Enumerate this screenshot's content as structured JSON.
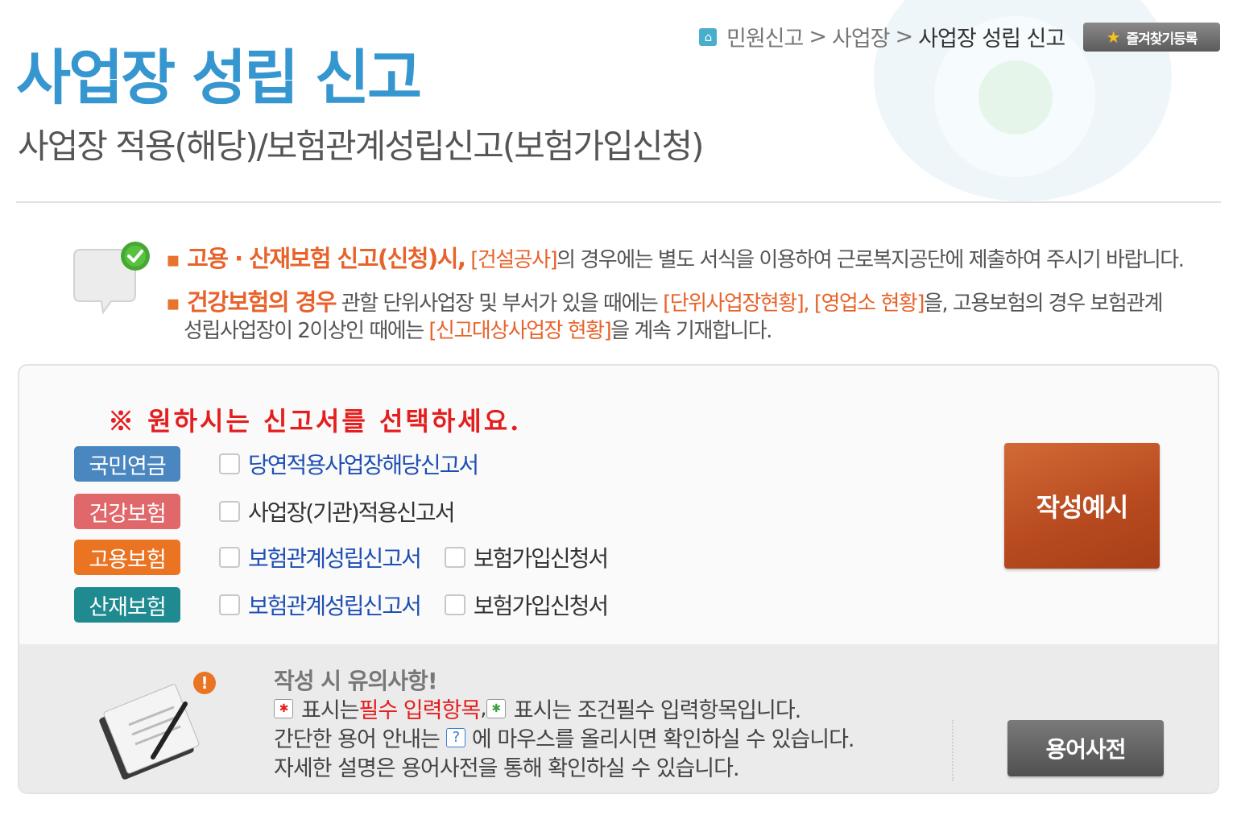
{
  "breadcrumb": {
    "items": [
      "민원신고",
      "사업장",
      "사업장 성립 신고"
    ],
    "separator": ">"
  },
  "favorites_button": {
    "label": "즐겨찾기등록",
    "icon": "star-icon"
  },
  "page": {
    "title": "사업장 성립 신고",
    "subtitle": "사업장 적용(해당)/보험관계성립신고(보험가입신청)"
  },
  "notices": {
    "n1": {
      "highlight": "고용 · 산재보험 신고(신청)시,",
      "link": "[건설공사]",
      "rest": "의 경우에는 별도 서식을 이용하여 근로복지공단에 제출하여 주시기 바랍니다."
    },
    "n2": {
      "highlight": "건강보험의 경우",
      "text1": " 관할 단위사업장 및 부서가 있을 때에는 ",
      "link1": "[단위사업장현황], [영업소 현황]",
      "text2": "을, 고용보험의 경우 보험관계",
      "text3": "성립사업장이 2이상인 때에는 ",
      "link2": "[신고대상사업장 현황]",
      "text4": "을 계속 기재합니다."
    }
  },
  "selection": {
    "heading": "※ 원하시는 신고서를 선택하세요.",
    "rows": [
      {
        "tag": "국민연금",
        "color": "#4a86c0",
        "options": [
          "당연적용사업장해당신고서"
        ]
      },
      {
        "tag": "건강보험",
        "color": "#e0676a",
        "options": [
          "사업장(기관)적용신고서"
        ]
      },
      {
        "tag": "고용보험",
        "color": "#ea7422",
        "options": [
          "보험관계성립신고서",
          "보험가입신청서"
        ]
      },
      {
        "tag": "산재보험",
        "color": "#1f8a90",
        "options": [
          "보험관계성립신고서",
          "보험가입신청서"
        ]
      }
    ],
    "example_button": "작성예시"
  },
  "info": {
    "title": "작성 시 유의사항!",
    "line1": {
      "pre": "표시는 ",
      "red": "필수 입력항목",
      "mid": ", ",
      "post": "표시는 조건필수 입력항목입니다."
    },
    "line2": {
      "pre": "간단한 용어 안내는 ",
      "post": "에 마우스를 올리시면 확인하실 수 있습니다."
    },
    "line3": "자세한 설명은 용어사전을 통해 확인하실 수 있습니다.",
    "dictionary_button": "용어사전"
  }
}
